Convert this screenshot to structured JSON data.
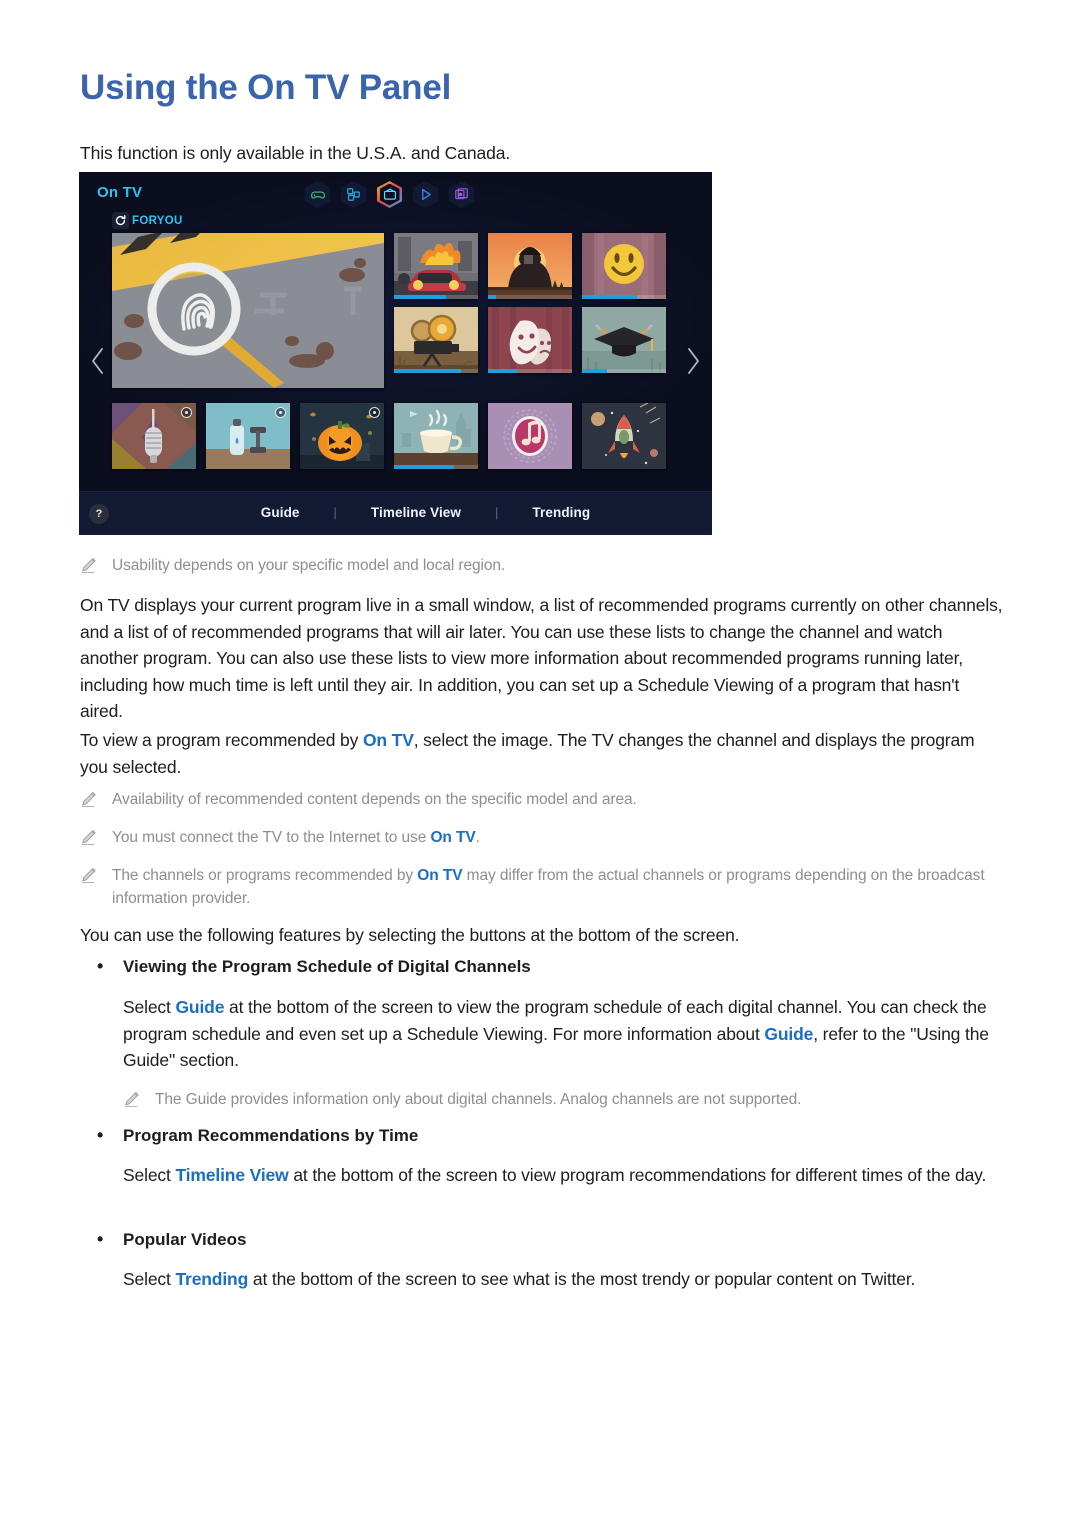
{
  "page": {
    "title": "Using the On TV Panel",
    "intro": "This function is only available in the U.S.A. and Canada."
  },
  "tv_panel": {
    "brand": "On TV",
    "row_label": "FORYOU",
    "refresh_icon": "refresh-icon",
    "nav_left_icon": "chevron-left-icon",
    "nav_right_icon": "chevron-right-icon",
    "help_label": "?",
    "hex_icons": [
      {
        "name": "games-icon",
        "color": "#3fc27a",
        "active": false
      },
      {
        "name": "apps-icon",
        "color": "#2f9fd8",
        "active": false
      },
      {
        "name": "tv-icon",
        "color": "#2fc2f0",
        "active": true
      },
      {
        "name": "play-icon",
        "color": "#3a7de0",
        "active": false
      },
      {
        "name": "multiview-icon",
        "color": "#9a5ad8",
        "active": false
      }
    ],
    "footer_menu": [
      {
        "label": "Guide"
      },
      {
        "label": "Timeline View"
      },
      {
        "label": "Trending"
      }
    ],
    "featured": {
      "name": "crime-scene-magnifier-thumbnail",
      "progress": 0
    },
    "thumbnails_top": [
      {
        "name": "burning-car-thumbnail",
        "progress": 62
      },
      {
        "name": "scarecrow-thumbnail",
        "progress": 10
      },
      {
        "name": "smiley-balloon-thumbnail",
        "progress": 65
      }
    ],
    "thumbnails_mid": [
      {
        "name": "film-projector-thumbnail",
        "progress": 80
      },
      {
        "name": "theatre-masks-thumbnail",
        "progress": 35
      },
      {
        "name": "graduation-cap-thumbnail",
        "progress": 30
      }
    ],
    "thumbnails_bottom": [
      {
        "name": "microphone-thumbnail",
        "progress": 0,
        "locked": true
      },
      {
        "name": "fitness-bottle-thumbnail",
        "progress": 0,
        "locked": true
      },
      {
        "name": "halloween-pumpkin-thumbnail",
        "progress": 0,
        "locked": true
      },
      {
        "name": "coffee-cup-thumbnail",
        "progress": 72,
        "locked": false
      },
      {
        "name": "music-note-thumbnail",
        "progress": 0,
        "locked": false
      },
      {
        "name": "rocket-thumbnail",
        "progress": 0,
        "locked": false
      }
    ]
  },
  "notes": {
    "usability": "Usability depends on your specific model and local region.",
    "availability": "Availability of recommended content depends on the specific model and area.",
    "internet_pre": "You must connect the TV to the Internet to use ",
    "internet_link": "On TV",
    "internet_post": ".",
    "differ_pre": "The channels or programs recommended by ",
    "differ_link": "On TV",
    "differ_post": " may differ from the actual channels or programs depending on the broadcast information provider.",
    "guide_digital": "The Guide provides information only about digital channels. Analog channels are not supported."
  },
  "body": {
    "paragraph1": "On TV displays your current program live in a small window, a list of recommended programs currently on other channels, and a list of of recommended programs that will air later. You can use these lists to change the channel and watch another program. You can also use these lists to view more information about recommended programs running later, including how much time is left until they air. In addition, you can set up a Schedule Viewing of a program that hasn't aired.",
    "paragraph2_pre": "To view a program recommended by ",
    "paragraph2_link": "On TV",
    "paragraph2_post": ", select the image. The TV changes the channel and displays the program you selected.",
    "features_intro": "You can use the following features by selecting the buttons at the bottom of the screen."
  },
  "sections": [
    {
      "heading": "Viewing the Program Schedule of Digital Channels",
      "text_pre": "Select ",
      "link1": "Guide",
      "text_mid": " at the bottom of the screen to view the program schedule of each digital channel. You can check the program schedule and even set up a Schedule Viewing. For more information about ",
      "link2": "Guide",
      "text_post": ", refer to the \"Using the Guide\" section."
    },
    {
      "heading": "Program Recommendations by Time",
      "text_pre": "Select ",
      "link1": "Timeline View",
      "text_post": " at the bottom of the screen to view program recommendations for different times of the day."
    },
    {
      "heading": "Popular Videos",
      "text_pre": "Select ",
      "link1": "Trending",
      "text_post": " at the bottom of the screen to see what is the most trendy or popular content on Twitter."
    }
  ],
  "colors": {
    "title_blue": "#3a64ac",
    "link_blue": "#1a6fc4",
    "panel_bg": "#0b0f20",
    "accent_cyan": "#2fc2f0",
    "progress_blue": "#1e9fe0"
  }
}
